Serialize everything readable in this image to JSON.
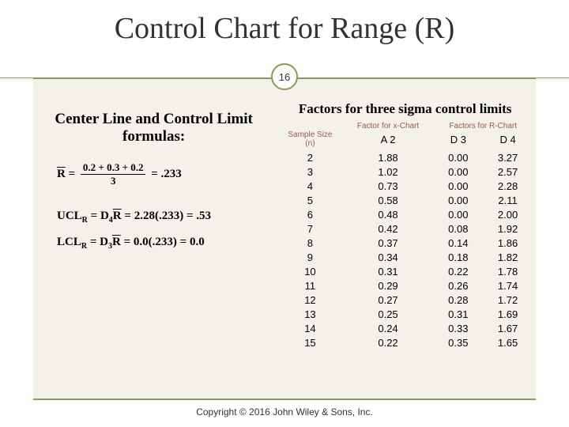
{
  "title": "Control Chart for Range (R)",
  "slide_number": "16",
  "left": {
    "heading": "Center Line and Control Limit formulas:",
    "rbar": {
      "numer": "0.2 + 0.3 + 0.2",
      "denom": "3",
      "result": ".233"
    },
    "ucl": {
      "calc": "2.28(.233)",
      "result": ".53"
    },
    "lcl": {
      "calc": "0.0(.233)",
      "result": "0.0"
    }
  },
  "table": {
    "title": "Factors for three sigma control limits",
    "group_x": "Factor for x-Chart",
    "group_r": "Factors for R-Chart",
    "headers": [
      "Sample Size",
      "A 2",
      "D 3",
      "D 4"
    ]
  },
  "chart_data": {
    "type": "table",
    "columns": [
      "n",
      "A2",
      "D3",
      "D4"
    ],
    "rows": [
      [
        2,
        1.88,
        0.0,
        3.27
      ],
      [
        3,
        1.02,
        0.0,
        2.57
      ],
      [
        4,
        0.73,
        0.0,
        2.28
      ],
      [
        5,
        0.58,
        0.0,
        2.11
      ],
      [
        6,
        0.48,
        0.0,
        2.0
      ],
      [
        7,
        0.42,
        0.08,
        1.92
      ],
      [
        8,
        0.37,
        0.14,
        1.86
      ],
      [
        9,
        0.34,
        0.18,
        1.82
      ],
      [
        10,
        0.31,
        0.22,
        1.78
      ],
      [
        11,
        0.29,
        0.26,
        1.74
      ],
      [
        12,
        0.27,
        0.28,
        1.72
      ],
      [
        13,
        0.25,
        0.31,
        1.69
      ],
      [
        14,
        0.24,
        0.33,
        1.67
      ],
      [
        15,
        0.22,
        0.35,
        1.65
      ]
    ]
  },
  "footer": "Copyright © 2016 John Wiley & Sons, Inc."
}
